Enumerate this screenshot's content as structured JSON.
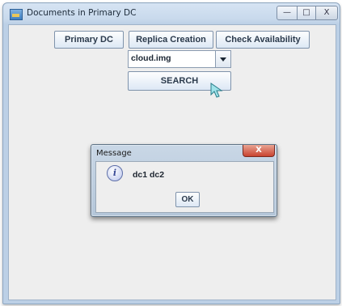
{
  "window": {
    "title": "Documents in Primary DC",
    "minimize_glyph": "—",
    "maximize_glyph": "□",
    "close_glyph": "X"
  },
  "toolbar": {
    "primary_dc_label": "Primary DC",
    "replica_creation_label": "Replica Creation",
    "check_availability_label": "Check Availability"
  },
  "file_select": {
    "selected_value": "cloud.img"
  },
  "search_button": {
    "label": "SEARCH"
  },
  "dialog": {
    "title": "Message",
    "close_glyph": "X",
    "icon": "info-icon",
    "icon_glyph": "i",
    "message": "dc1 dc2",
    "ok_label": "OK"
  }
}
